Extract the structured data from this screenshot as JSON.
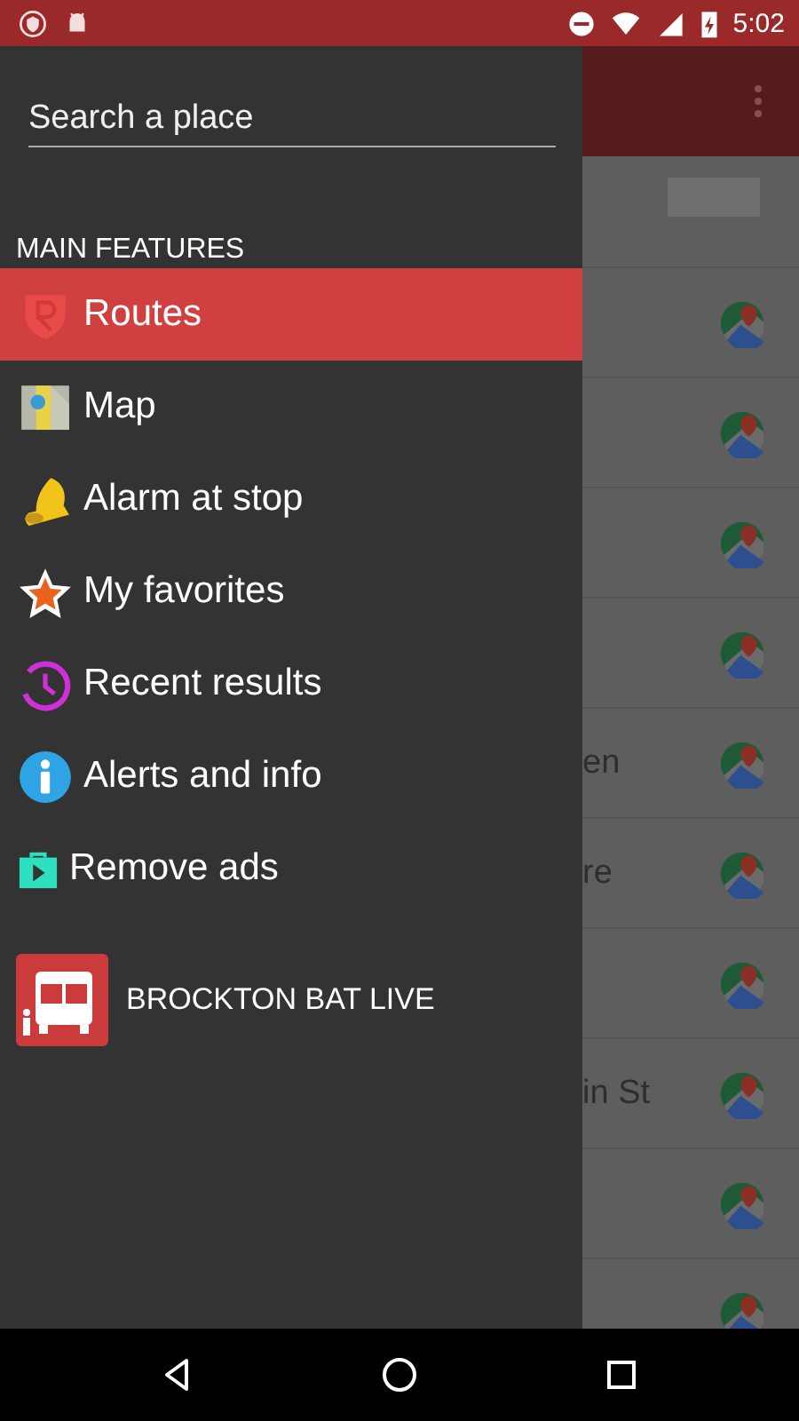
{
  "status_bar": {
    "time": "5:02"
  },
  "drawer": {
    "search": {
      "placeholder": "Search a place"
    },
    "section_title": "MAIN FEATURES",
    "items": [
      {
        "kind": "routes",
        "label": "Routes",
        "selected": true
      },
      {
        "kind": "map",
        "label": "Map",
        "selected": false
      },
      {
        "kind": "alarm",
        "label": "Alarm at stop",
        "selected": false
      },
      {
        "kind": "favorites",
        "label": "My favorites",
        "selected": false
      },
      {
        "kind": "recent",
        "label": "Recent results",
        "selected": false
      },
      {
        "kind": "alerts",
        "label": "Alerts and info",
        "selected": false
      },
      {
        "kind": "store",
        "label": "Remove ads",
        "selected": false
      }
    ],
    "app_link": {
      "label": "BROCKTON BAT LIVE"
    }
  },
  "background_list": {
    "rows": [
      {},
      {},
      {},
      {},
      {
        "text": "en"
      },
      {
        "text": "re"
      },
      {},
      {
        "text": "in St"
      },
      {},
      {}
    ]
  }
}
